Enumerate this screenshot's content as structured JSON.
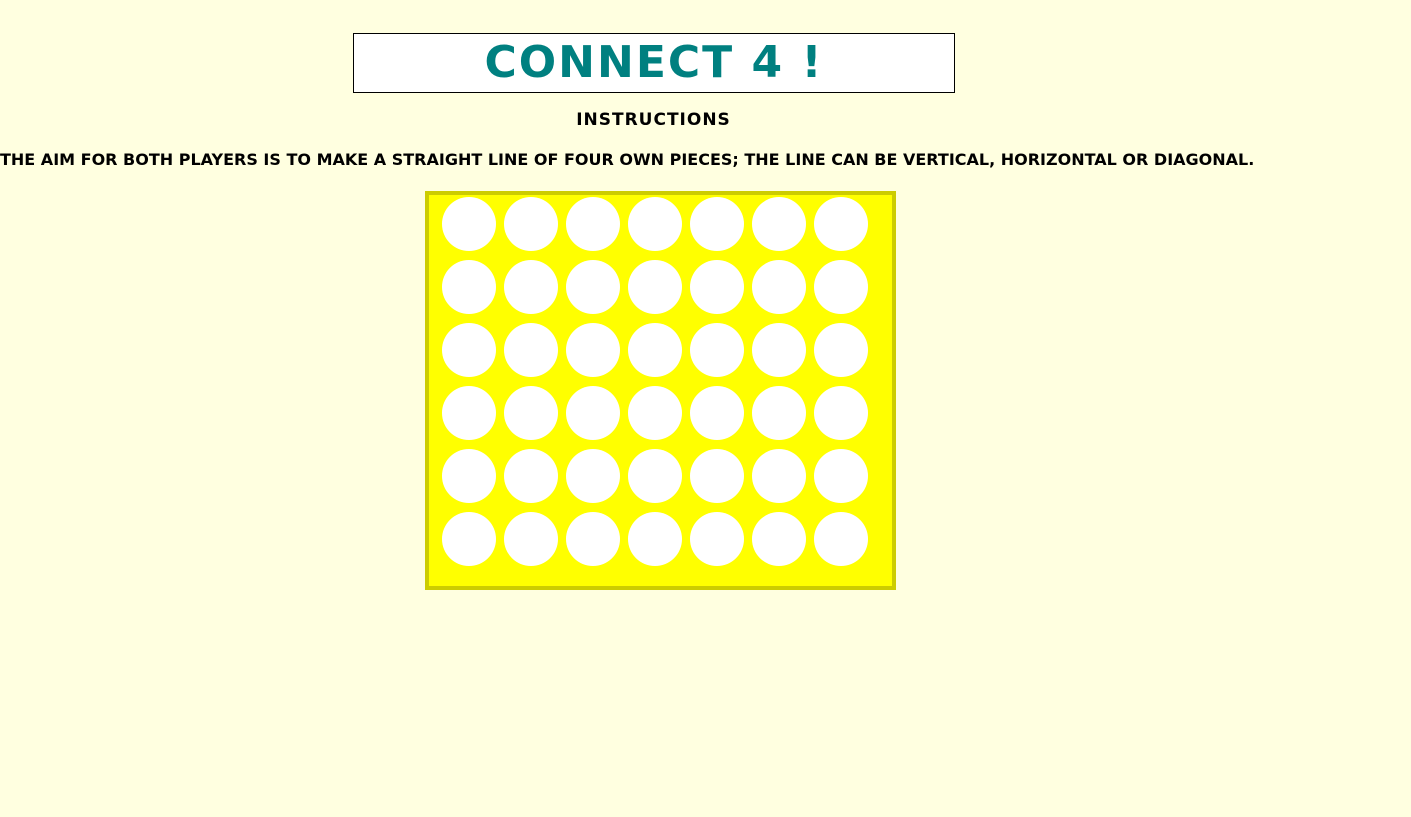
{
  "header": {
    "title": "Connect 4 !"
  },
  "instructions": {
    "heading": "Instructions",
    "text": "The aim for both players is to make a straight line of four own pieces; the line can be vertical, horizontal or diagonal."
  },
  "board": {
    "rows": 6,
    "columns": 7,
    "colors": {
      "board": "#ffff00",
      "border": "#cccc00",
      "empty_slot": "#ffffff"
    }
  },
  "colors": {
    "background": "#ffffe0",
    "title": "#008080",
    "text": "#000000"
  }
}
